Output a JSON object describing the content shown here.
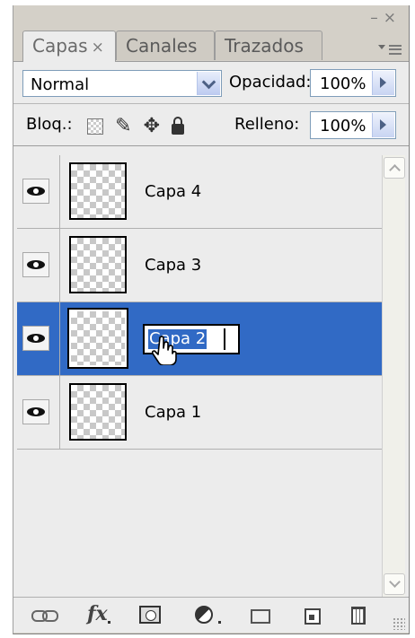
{
  "window": {
    "minimize": "–",
    "close": "×"
  },
  "tabs": [
    {
      "label": "Capas",
      "close": "×",
      "active": true
    },
    {
      "label": "Canales",
      "active": false
    },
    {
      "label": "Trazados",
      "active": false
    }
  ],
  "blend": {
    "mode": "Normal",
    "opacity_label": "Opacidad:",
    "opacity_value": "100%"
  },
  "lock": {
    "label": "Bloq.:",
    "fill_label": "Relleno:",
    "fill_value": "100%"
  },
  "layers": [
    {
      "name": "Capa 4",
      "visible": true,
      "selected": false
    },
    {
      "name": "Capa 3",
      "visible": true,
      "selected": false
    },
    {
      "name": "Capa 2",
      "visible": true,
      "selected": true,
      "editing": true
    },
    {
      "name": "Capa 1",
      "visible": true,
      "selected": false
    }
  ],
  "bottom_icons": [
    "link-layers-icon",
    "fx-icon",
    "layer-mask-icon",
    "adjustment-layer-icon",
    "new-group-icon",
    "new-layer-icon",
    "delete-layer-icon"
  ],
  "colors": {
    "selection": "#316ac5",
    "panel_bg": "#ececec",
    "chrome": "#d4d0c8"
  }
}
